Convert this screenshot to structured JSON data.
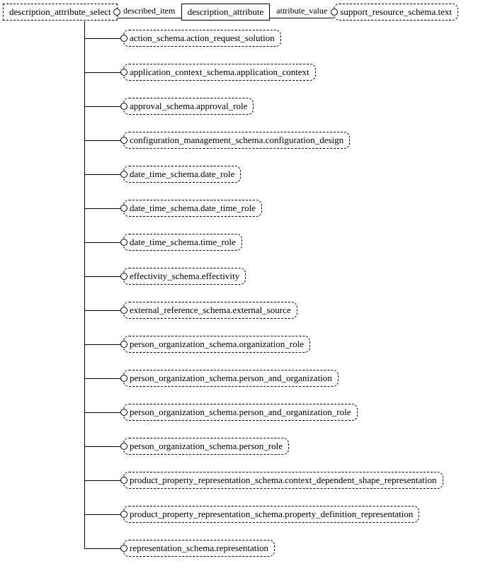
{
  "root": {
    "select_entity": "description_attribute_select",
    "center_entity": "description_attribute",
    "right_entity": "support_resource_schema.text",
    "edge_left_label": "described_item",
    "edge_right_label": "attribute_value"
  },
  "children": [
    "action_schema.action_request_solution",
    "application_context_schema.application_context",
    "approval_schema.approval_role",
    "configuration_management_schema.configuration_design",
    "date_time_schema.date_role",
    "date_time_schema.date_time_role",
    "date_time_schema.time_role",
    "effectivity_schema.effectivity",
    "external_reference_schema.external_source",
    "person_organization_schema.organization_role",
    "person_organization_schema.person_and_organization",
    "person_organization_schema.person_and_organization_role",
    "person_organization_schema.person_role",
    "product_property_representation_schema.context_dependent_shape_representation",
    "product_property_representation_schema.property_definition_representation",
    "representation_schema.representation"
  ]
}
